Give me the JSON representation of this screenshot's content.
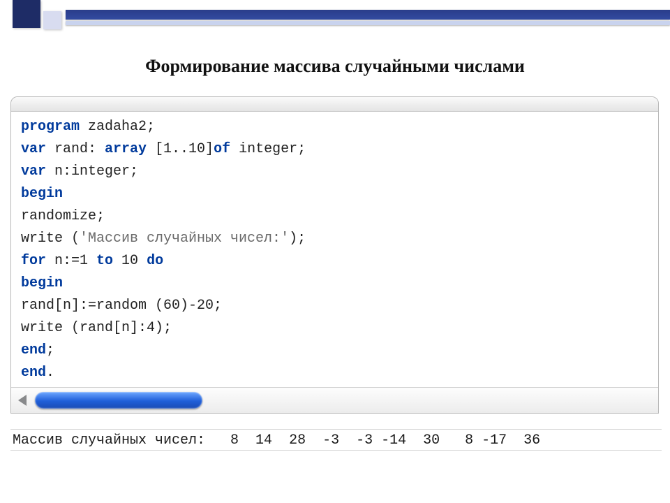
{
  "title": "Формирование массива случайными числами",
  "code": {
    "l1_kw": "program",
    "l1_rest": " zadaha2;",
    "l2_kw1": "var",
    "l2_mid1": " rand: ",
    "l2_kw2": "array",
    "l2_mid2": " [1..10]",
    "l2_kw3": "of",
    "l2_rest": " integer;",
    "l3_kw": "var",
    "l3_rest": " n:integer;",
    "l4_kw": "begin",
    "l5": "randomize;",
    "l6_pre": "write (",
    "l6_str": "'Массив случайных чисел:'",
    "l6_post": ");",
    "l7_kw1": "for",
    "l7_mid1": " n:=1 ",
    "l7_kw2": "to",
    "l7_mid2": " 10 ",
    "l7_kw3": "do",
    "l8_kw": "begin",
    "l9": "rand[n]:=random (60)-20;",
    "l10": "write (rand[n]:4);",
    "l11_kw": "end",
    "l11_rest": ";",
    "l12_kw": "end",
    "l12_rest": "."
  },
  "output": {
    "label": "Массив случайных чисел:",
    "values": [
      8,
      14,
      28,
      -3,
      -3,
      -14,
      30,
      8,
      -17,
      36
    ],
    "line": "Массив случайных чисел:   8  14  28  -3  -3 -14  30   8 -17  36"
  }
}
